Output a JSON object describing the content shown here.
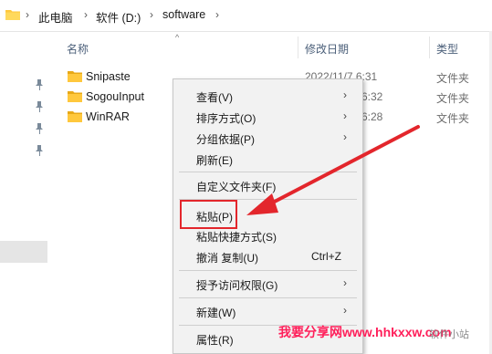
{
  "breadcrumb": {
    "items": [
      "此电脑",
      "软件 (D:)",
      "software"
    ],
    "separator": "›",
    "folder_icon": "folder-icon"
  },
  "columns": {
    "name": "名称",
    "date": "修改日期",
    "type": "类型"
  },
  "files": [
    {
      "name": "Snipaste",
      "date": "2022/11/7 6:31",
      "type": "文件夹"
    },
    {
      "name": "SogouInput",
      "date": "6:32",
      "type": "文件夹"
    },
    {
      "name": "WinRAR",
      "date": "6:28",
      "type": "文件夹"
    }
  ],
  "context_menu": {
    "view": "查看(V)",
    "sort": "排序方式(O)",
    "group": "分组依据(P)",
    "refresh": "刷新(E)",
    "customize": "自定义文件夹(F)",
    "paste": "粘贴(P)",
    "paste_shortcut": "粘贴快捷方式(S)",
    "undo": "撤消 复制(U)",
    "undo_shortcut": "Ctrl+Z",
    "give_access": "授予访问权限(G)",
    "new": "新建(W)",
    "properties": "属性(R)"
  },
  "watermark": "我要分享网www.hhkxxw.com",
  "brand": "软件小站",
  "colors": {
    "highlight": "#e3262c",
    "arrow": "#e3262c",
    "folder": "#ffc83d",
    "watermark": "#ff1f5a"
  }
}
